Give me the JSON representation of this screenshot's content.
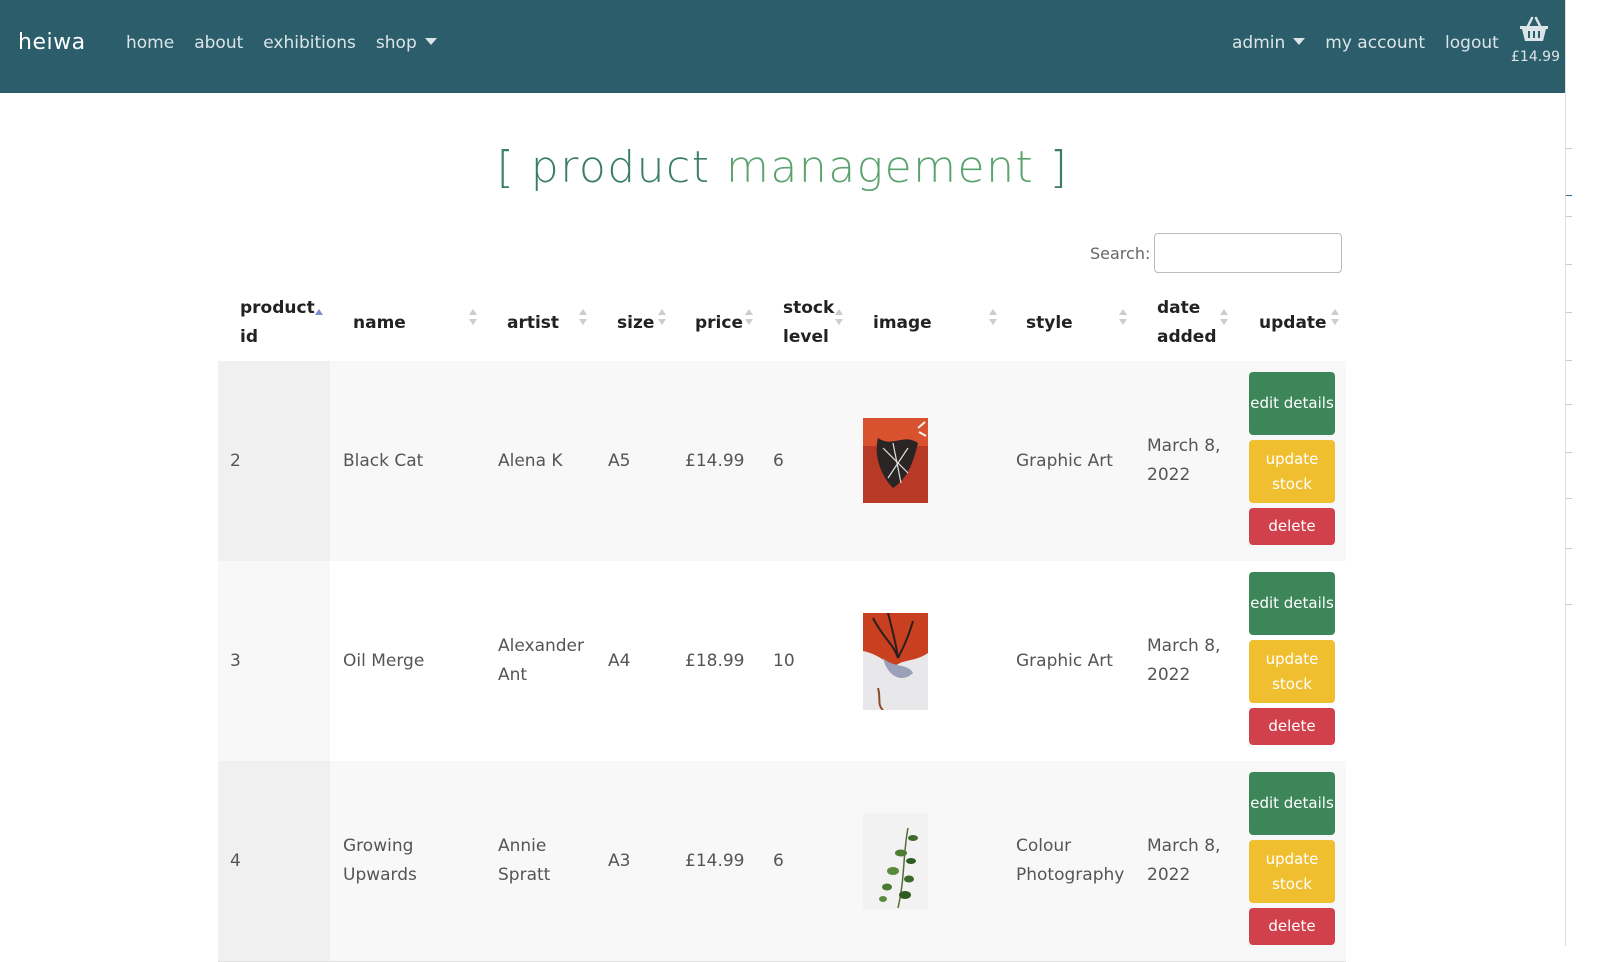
{
  "nav": {
    "brand": "heiwa",
    "left": [
      "home",
      "about",
      "exhibitions",
      "shop"
    ],
    "right": [
      "admin",
      "my account",
      "logout"
    ],
    "basket_total": "£14.99",
    "icons": {
      "basket": "basket-icon",
      "caret": "caret-down-icon"
    }
  },
  "page": {
    "title_open": "[",
    "title_main": "product",
    "title_accent": "management",
    "title_close": "]"
  },
  "search": {
    "label": "Search:",
    "value": ""
  },
  "table": {
    "headers": [
      "product id",
      "name",
      "artist",
      "size",
      "price",
      "stock level",
      "image",
      "style",
      "date added",
      "update"
    ],
    "sorted_column": "product id",
    "rows": [
      {
        "id": "2",
        "name": "Black Cat",
        "artist": "Alena K",
        "size": "A5",
        "price": "£14.99",
        "stock": "6",
        "style": "Graphic Art",
        "date": "March 8, 2022"
      },
      {
        "id": "3",
        "name": "Oil Merge",
        "artist": "Alexander Ant",
        "size": "A4",
        "price": "£18.99",
        "stock": "10",
        "style": "Graphic Art",
        "date": "March 8, 2022"
      },
      {
        "id": "4",
        "name": "Growing Upwards",
        "artist": "Annie Spratt",
        "size": "A3",
        "price": "£14.99",
        "stock": "6",
        "style": "Colour Photography",
        "date": "March 8, 2022"
      }
    ],
    "buttons": {
      "edit": "edit details",
      "stock": "update stock",
      "delete": "delete"
    }
  },
  "colors": {
    "navbar": "#2b5d6b",
    "title": "#3f8a66",
    "edit": "#3c8659",
    "stock": "#efbf30",
    "delete": "#d1414b"
  }
}
